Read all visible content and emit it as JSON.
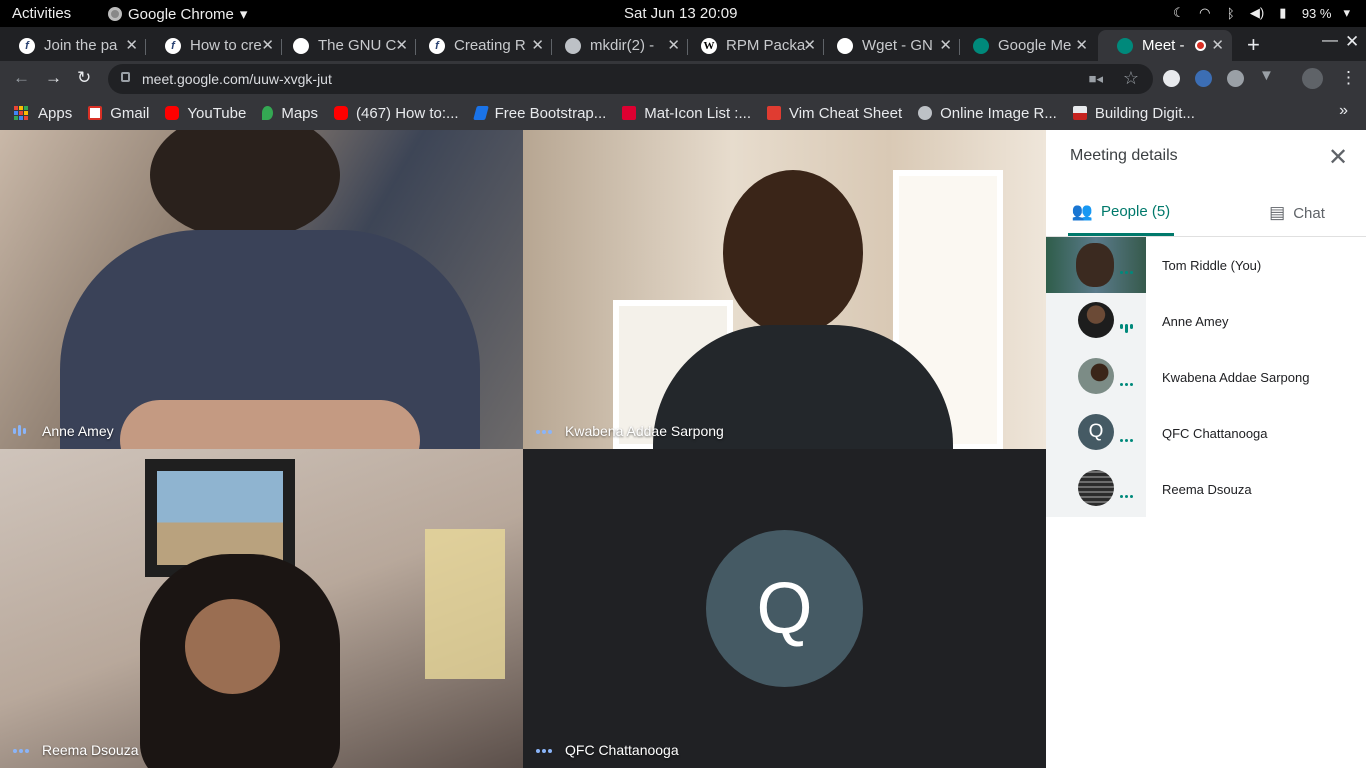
{
  "system_bar": {
    "activities": "Activities",
    "app_name": "Google Chrome",
    "clock": "Sat Jun 13  20:09",
    "battery": "93 %"
  },
  "browser": {
    "tabs": [
      {
        "title": "Join the pa",
        "favicon": "fedora-icon"
      },
      {
        "title": "How to cre",
        "favicon": "fedora-icon"
      },
      {
        "title": "The GNU C",
        "favicon": "gnu-icon"
      },
      {
        "title": "Creating R",
        "favicon": "fedora-icon"
      },
      {
        "title": "mkdir(2) -",
        "favicon": "globe-icon"
      },
      {
        "title": "RPM Packa",
        "favicon": "wikipedia-icon"
      },
      {
        "title": "Wget - GN",
        "favicon": "gnu-icon"
      },
      {
        "title": "Google Me",
        "favicon": "meet-icon"
      },
      {
        "title": "Meet - ",
        "favicon": "meet-icon",
        "active": true,
        "recording": true
      }
    ],
    "url": "meet.google.com/uuw-xvgk-jut",
    "bookmarks": [
      {
        "label": "Apps",
        "icon": "apps-grid-icon"
      },
      {
        "label": "Gmail",
        "icon": "gmail-icon"
      },
      {
        "label": "YouTube",
        "icon": "youtube-icon"
      },
      {
        "label": "Maps",
        "icon": "maps-icon"
      },
      {
        "label": "(467) How to:...",
        "icon": "youtube-icon"
      },
      {
        "label": "Free Bootstrap...",
        "icon": "bootstrap-icon"
      },
      {
        "label": "Mat-Icon List :...",
        "icon": "angular-icon"
      },
      {
        "label": "Vim Cheat Sheet",
        "icon": "vim-icon"
      },
      {
        "label": "Online Image R...",
        "icon": "globe-icon"
      },
      {
        "label": "Building Digit...",
        "icon": "flag-icon"
      }
    ]
  },
  "meeting": {
    "tiles": [
      {
        "name": "Anne Amey",
        "indicator": "speaking"
      },
      {
        "name": "Kwabena Addae Sarpong",
        "indicator": "dots"
      },
      {
        "name": "Reema Dsouza",
        "indicator": "dots"
      },
      {
        "name": "QFC Chattanooga",
        "indicator": "dots",
        "avatar_letter": "Q"
      }
    ]
  },
  "panel": {
    "title": "Meeting details",
    "tabs": {
      "people": "People (5)",
      "chat": "Chat"
    },
    "participants": [
      {
        "name": "Tom Riddle (You)"
      },
      {
        "name": "Anne Amey"
      },
      {
        "name": "Kwabena Addae Sarpong"
      },
      {
        "name": "QFC Chattanooga",
        "avatar_letter": "Q"
      },
      {
        "name": "Reema Dsouza"
      }
    ]
  },
  "colors": {
    "accent_teal": "#00796b",
    "avatar_slate": "#455a64",
    "recording_red": "#d93025"
  }
}
